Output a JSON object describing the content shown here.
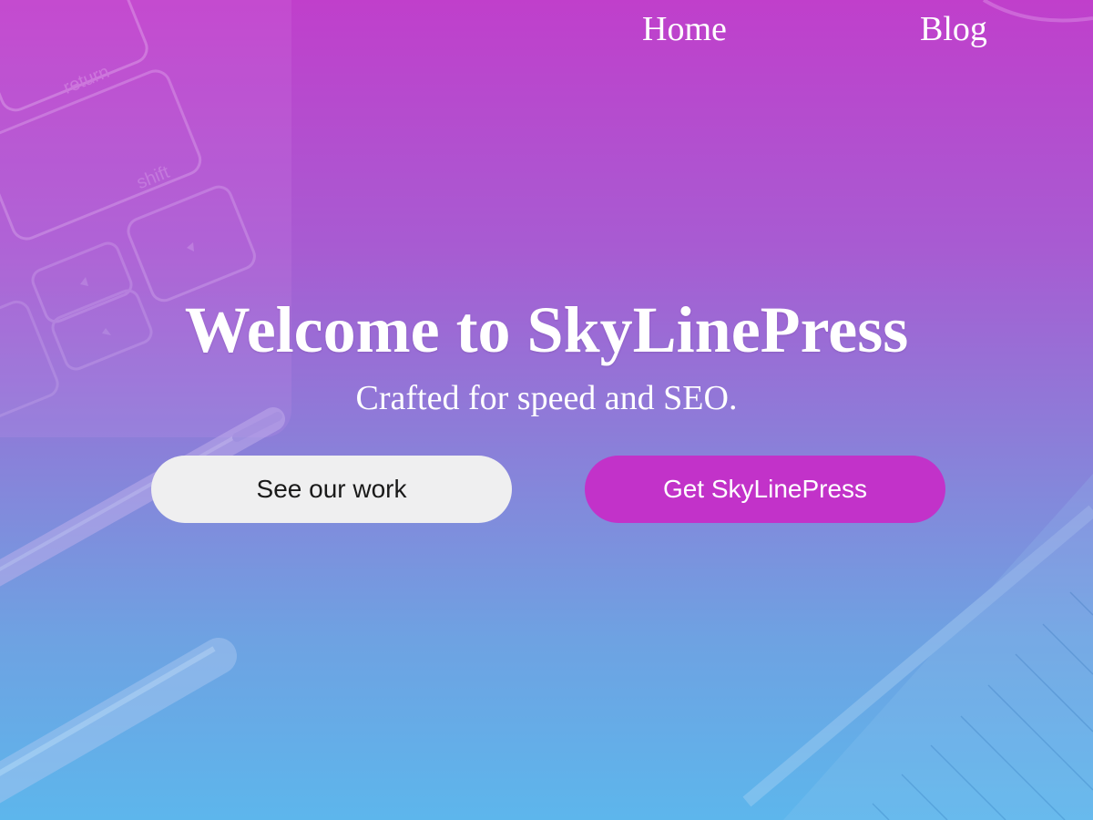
{
  "nav": {
    "items": [
      {
        "label": "Home"
      },
      {
        "label": "Blog"
      }
    ]
  },
  "hero": {
    "title": "Welcome to SkyLinePress",
    "tagline": "Crafted for speed and SEO.",
    "secondary_button": "See our work",
    "primary_button": "Get SkyLinePress"
  },
  "background": {
    "keyboard_keys": [
      "return",
      "shift"
    ]
  },
  "colors": {
    "gradient_top": "#c03fcb",
    "gradient_bottom": "#5db6ec",
    "primary_button": "#c232c9",
    "secondary_button": "#efeff0",
    "text": "#ffffff"
  }
}
